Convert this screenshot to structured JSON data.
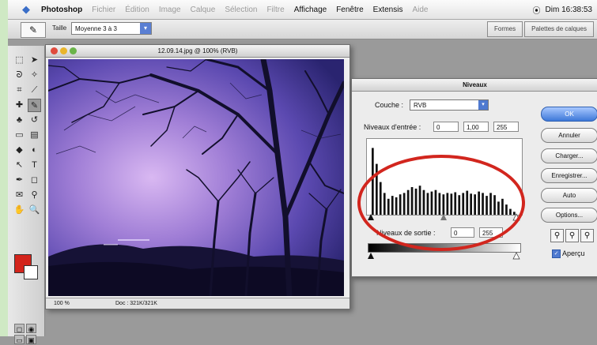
{
  "menubar": {
    "app_name": "Photoshop",
    "items": [
      "Fichier",
      "Édition",
      "Image",
      "Calque",
      "Sélection",
      "Filtre",
      "Affichage",
      "Fenêtre",
      "Extensis",
      "Aide"
    ],
    "dim_items": [
      1,
      2,
      3,
      4,
      5,
      6,
      9
    ],
    "clock": "Dim 16:38:53"
  },
  "optbar": {
    "tool": "✎",
    "size_label": "Taille",
    "size_value": "Moyenne 3 à 3",
    "palette_tabs": [
      "Formes",
      "Palettes de calques"
    ]
  },
  "document": {
    "title": "12.09.14.jpg @ 100% (RVB)",
    "status_zoom": "100 %",
    "status_doc": "Doc : 321K/321K"
  },
  "levels": {
    "title": "Niveaux",
    "channel_label": "Couche :",
    "channel_value": "RVB",
    "input_label": "Niveaux d'entrée :",
    "input_values": [
      "0",
      "1,00",
      "255"
    ],
    "output_label": "Niveaux de sortie :",
    "output_values": [
      "0",
      "255"
    ],
    "buttons": [
      "OK",
      "Annuler",
      "Charger...",
      "Enregistrer...",
      "Auto",
      "Options..."
    ],
    "preview_label": "Aperçu",
    "preview_checked": true,
    "histogram": [
      92,
      70,
      45,
      30,
      22,
      26,
      24,
      28,
      30,
      34,
      38,
      36,
      40,
      34,
      30,
      32,
      34,
      30,
      28,
      30,
      29,
      31,
      27,
      30,
      33,
      29,
      28,
      32,
      30,
      26,
      30,
      27,
      18,
      22,
      14,
      8,
      4
    ]
  },
  "colors": {
    "foreground": "#d3241b",
    "background": "#ffffff",
    "highlight_ellipse": "#d2261e"
  }
}
